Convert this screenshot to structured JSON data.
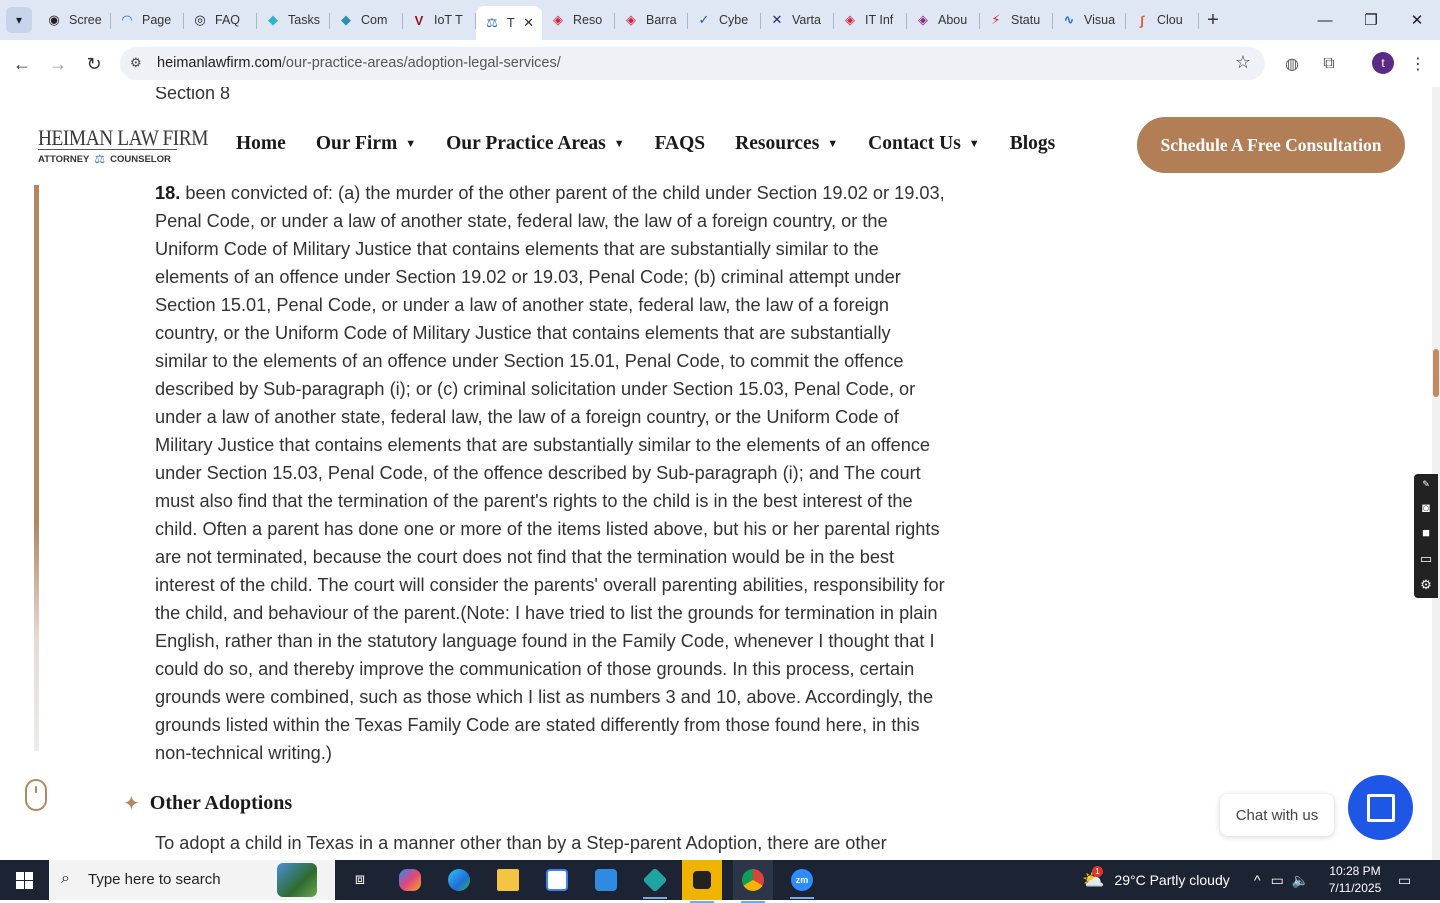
{
  "browser": {
    "tabs": [
      {
        "label": "Scree",
        "color": "#1f1f1f",
        "glyph": "◉"
      },
      {
        "label": "Page",
        "color": "#2a6fdb",
        "glyph": "◠"
      },
      {
        "label": "FAQ",
        "color": "#1f1f1f",
        "glyph": "◎"
      },
      {
        "label": "Tasks",
        "color": "#2fb4c9",
        "glyph": "◆"
      },
      {
        "label": "Com",
        "color": "#2a8fb0",
        "glyph": "◆"
      },
      {
        "label": "IoT T",
        "color": "#8b1a1a",
        "glyph": "V"
      },
      {
        "label": "T",
        "color": "#2b6cb0",
        "glyph": "⚖"
      },
      {
        "label": "Reso",
        "color": "#d4213d",
        "glyph": "◈"
      },
      {
        "label": "Barra",
        "color": "#d4213d",
        "glyph": "◈"
      },
      {
        "label": "Cybe",
        "color": "#2255aa",
        "glyph": "✓"
      },
      {
        "label": "Varta",
        "color": "#1a2a6c",
        "glyph": "✕"
      },
      {
        "label": "IT Inf",
        "color": "#d4213d",
        "glyph": "◈"
      },
      {
        "label": "Abou",
        "color": "#8e2c7a",
        "glyph": "◈"
      },
      {
        "label": "Statu",
        "color": "#d4213d",
        "glyph": "⚡"
      },
      {
        "label": "Visua",
        "color": "#1e6fd9",
        "glyph": "∿"
      },
      {
        "label": "Clou",
        "color": "#e2572b",
        "glyph": "∫"
      }
    ],
    "url_host": "heimanlawfirm.com",
    "url_path": "/our-practice-areas/adoption-legal-services/",
    "profile_initial": "t"
  },
  "site": {
    "logo_title": "HEIMAN LAW FIRM",
    "logo_left": "ATTORNEY",
    "logo_right": "COUNSELOR",
    "nav": [
      {
        "label": "Home",
        "dropdown": false
      },
      {
        "label": "Our Firm",
        "dropdown": true
      },
      {
        "label": "Our Practice Areas",
        "dropdown": true
      },
      {
        "label": "FAQS",
        "dropdown": false
      },
      {
        "label": "Resources",
        "dropdown": true
      },
      {
        "label": "Contact Us",
        "dropdown": true
      },
      {
        "label": "Blogs",
        "dropdown": false
      }
    ],
    "cta": "Schedule A Free Consultation"
  },
  "content": {
    "cut_line": "Section 8",
    "item_number": "18.",
    "paragraph": "been convicted of: (a) the murder of the other parent of the child under Section 19.02 or 19.03, Penal Code, or under a law of another state, federal law, the law of a foreign country, or the Uniform Code of Military Justice that contains elements that are substantially similar to the elements of an offence under Section 19.02 or 19.03, Penal Code; (b) criminal attempt under Section 15.01, Penal Code, or under a law of another state, federal law, the law of a foreign country, or the Uniform Code of Military Justice that contains elements that are substantially similar to the elements of an offence under Section 15.01, Penal Code, to commit the offence described by Sub-paragraph (i); or (c) criminal solicitation under Section 15.03, Penal Code, or under a law of another state, federal law, the law of a foreign country, or the Uniform Code of Military Justice that contains elements that are substantially similar to the elements of an offence under Section 15.03, Penal Code, of the offence described by Sub-paragraph (i); and The court must also find that the termination of the parent's rights to the child is in the best interest of the child. Often a parent has done one or more of the items listed above, but his or her parental rights are not terminated, because the court does not find that the termination would be in the best interest of the child. The court will consider the parents' overall parenting abilities, responsibility for the child, and behaviour of the parent.(Note: I have tried to list the grounds for termination in plain English, rather than in the statutory language found in the Family Code, whenever I thought that I could do so, and thereby improve the communication of those grounds. In this process, certain grounds were combined, such as those which I list as numbers 3 and 10, above. Accordingly, the grounds listed within the Texas Family Code are stated differently from those found here, in this non-technical writing.)",
    "section_heading": "Other Adoptions",
    "next_paragraph": "To adopt a child in Texas in a manner other than by a Step-parent Adoption, there are other"
  },
  "chat": {
    "label": "Chat with us"
  },
  "taskbar": {
    "search_placeholder": "Type here to search",
    "weather": "29°C  Partly cloudy",
    "weather_badge": "1",
    "time": "10:28 PM",
    "date": "7/11/2025"
  }
}
